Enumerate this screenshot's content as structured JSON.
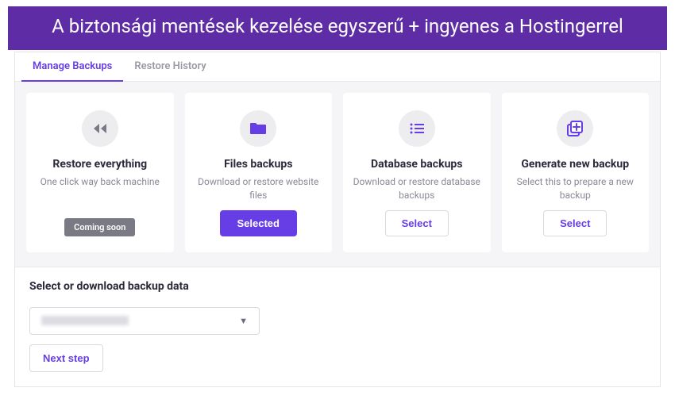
{
  "banner": {
    "text": "A biztonsági mentések kezelése egyszerű + ingyenes a Hostingerrel"
  },
  "tabs": [
    {
      "label": "Manage Backups",
      "active": true
    },
    {
      "label": "Restore History",
      "active": false
    }
  ],
  "cards": [
    {
      "icon": "rewind",
      "title": "Restore everything",
      "description": "One click way back machine",
      "action_type": "badge",
      "action_label": "Coming soon"
    },
    {
      "icon": "folder",
      "title": "Files backups",
      "description": "Download or restore website files",
      "action_type": "primary",
      "action_label": "Selected"
    },
    {
      "icon": "list",
      "title": "Database backups",
      "description": "Download or restore database backups",
      "action_type": "outline",
      "action_label": "Select"
    },
    {
      "icon": "add-copy",
      "title": "Generate new backup",
      "description": "Select this to prepare a new backup",
      "action_type": "outline",
      "action_label": "Select"
    }
  ],
  "lower": {
    "title": "Select or download backup data",
    "dropdown_value": "",
    "next_label": "Next step"
  },
  "colors": {
    "accent": "#673DE6",
    "banner_bg": "#5E2CA5"
  }
}
